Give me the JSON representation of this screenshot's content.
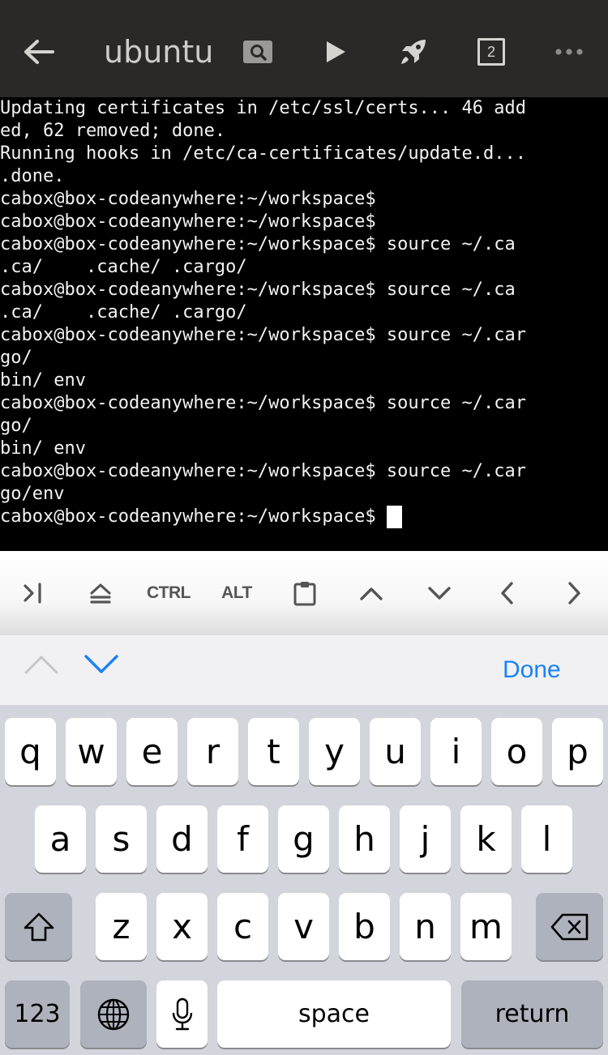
{
  "header": {
    "title": "ubuntu",
    "tab_count": "2",
    "icons": [
      "back-arrow-icon",
      "search-icon",
      "play-icon",
      "rocket-icon",
      "tabs-count-icon",
      "more-icon"
    ]
  },
  "terminal": {
    "lines": [
      "Updating certificates in /etc/ssl/certs... 46 add",
      "ed, 62 removed; done.",
      "Running hooks in /etc/ca-certificates/update.d...",
      ".done.",
      "cabox@box-codeanywhere:~/workspace$",
      "cabox@box-codeanywhere:~/workspace$",
      "cabox@box-codeanywhere:~/workspace$ source ~/.ca",
      ".ca/    .cache/ .cargo/",
      "cabox@box-codeanywhere:~/workspace$ source ~/.ca",
      ".ca/    .cache/ .cargo/",
      "cabox@box-codeanywhere:~/workspace$ source ~/.car",
      "go/",
      "bin/ env",
      "cabox@box-codeanywhere:~/workspace$ source ~/.car",
      "go/",
      "bin/ env",
      "cabox@box-codeanywhere:~/workspace$ source ~/.car",
      "go/env",
      "cabox@box-codeanywhere:~/workspace$ "
    ]
  },
  "accessory": {
    "ctrl_label": "CTRL",
    "alt_label": "ALT"
  },
  "keyboard_nav": {
    "done_label": "Done"
  },
  "keyboard": {
    "row1": [
      "q",
      "w",
      "e",
      "r",
      "t",
      "y",
      "u",
      "i",
      "o",
      "p"
    ],
    "row2": [
      "a",
      "s",
      "d",
      "f",
      "g",
      "h",
      "j",
      "k",
      "l"
    ],
    "row3": [
      "z",
      "x",
      "c",
      "v",
      "b",
      "n",
      "m"
    ],
    "numbers_label": "123",
    "space_label": "space",
    "return_label": "return"
  },
  "colors": {
    "header_bg": "#2b2827",
    "terminal_bg": "#000000",
    "terminal_fg": "#f2f2f2",
    "accent_blue": "#1a82f7",
    "keyboard_bg": "#d2d5db"
  }
}
